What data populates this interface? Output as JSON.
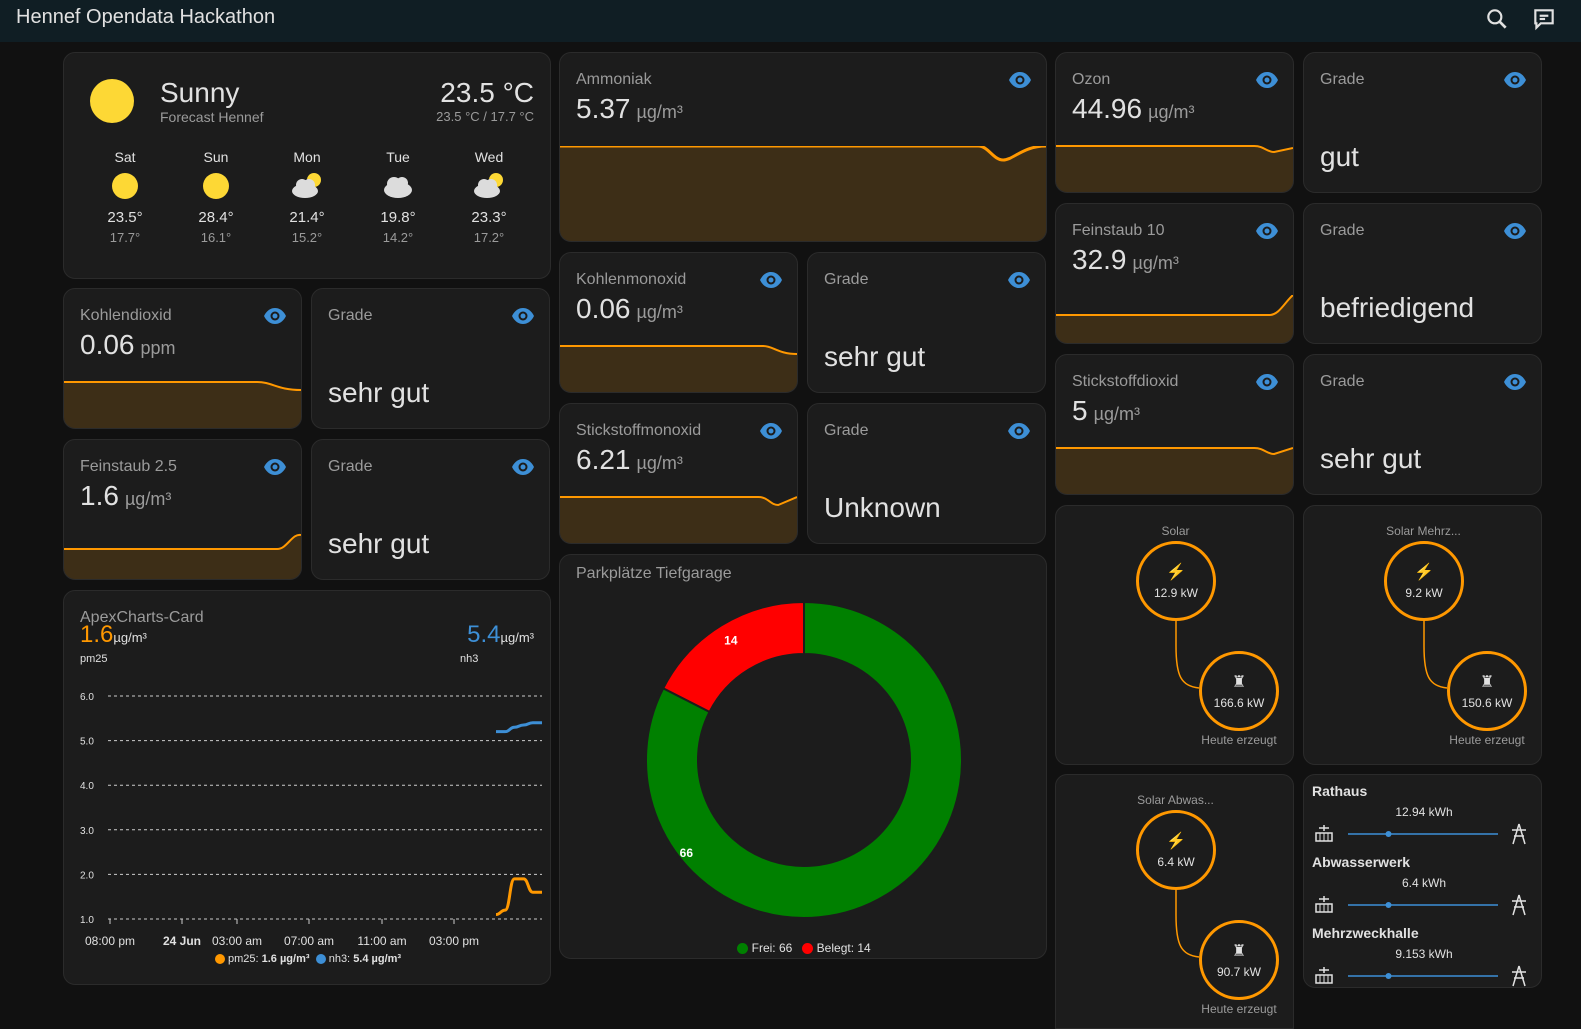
{
  "header": {
    "title": "Hennef Opendata Hackathon",
    "icons": [
      "search-icon",
      "assist-icon"
    ]
  },
  "weather": {
    "condition": "Sunny",
    "subtitle": "Forecast Hennef",
    "temperature": "23.5 °C",
    "range": "23.5 °C / 17.7 °C",
    "forecast": [
      {
        "day": "Sat",
        "icon": "sunny",
        "high": "23.5°",
        "low": "17.7°"
      },
      {
        "day": "Sun",
        "icon": "sunny",
        "high": "28.4°",
        "low": "16.1°"
      },
      {
        "day": "Mon",
        "icon": "partlycloudy",
        "high": "21.4°",
        "low": "15.2°"
      },
      {
        "day": "Tue",
        "icon": "cloudy",
        "high": "19.8°",
        "low": "14.2°"
      },
      {
        "day": "Wed",
        "icon": "partlycloudy",
        "high": "23.3°",
        "low": "17.2°"
      }
    ]
  },
  "sensors": {
    "co2": {
      "name": "Kohlendioxid",
      "value": "0.06",
      "unit": "ppm"
    },
    "pm25": {
      "name": "Feinstaub 2.5",
      "value": "1.6",
      "unit": "µg/m³"
    },
    "nh3": {
      "name": "Ammoniak",
      "value": "5.37",
      "unit": "µg/m³"
    },
    "co": {
      "name": "Kohlenmonoxid",
      "value": "0.06",
      "unit": "µg/m³"
    },
    "no": {
      "name": "Stickstoffmonoxid",
      "value": "6.21",
      "unit": "µg/m³"
    },
    "o3": {
      "name": "Ozon",
      "value": "44.96",
      "unit": "µg/m³"
    },
    "pm10": {
      "name": "Feinstaub 10",
      "value": "32.9",
      "unit": "µg/m³"
    },
    "no2": {
      "name": "Stickstoffdioxid",
      "value": "5",
      "unit": "µg/m³"
    }
  },
  "grades": {
    "label": "Grade",
    "co2": "sehr gut",
    "pm25": "sehr gut",
    "co": "sehr gut",
    "no": "Unknown",
    "o3": "gut",
    "pm10": "befriedigend",
    "no2": "sehr gut"
  },
  "apex": {
    "title": "ApexCharts-Card",
    "s1_value": "1.6",
    "s1_unit": "µg/m³",
    "s1_name": "pm25",
    "s2_value": "5.4",
    "s2_unit": "µg/m³",
    "s2_name": "nh3",
    "legend1_label": "pm25:",
    "legend1_value": "1.6 µg/m³",
    "legend2_label": "nh3:",
    "legend2_value": "5.4 µg/m³"
  },
  "chart_data": [
    {
      "type": "line",
      "title": "ApexCharts-Card",
      "y_ticks": [
        "6.0",
        "5.0",
        "4.0",
        "3.0",
        "2.0",
        "1.0"
      ],
      "ylim": [
        1.0,
        6.0
      ],
      "x_ticks": [
        "08:00 pm",
        "24 Jun",
        "03:00 am",
        "07:00 am",
        "11:00 am",
        "03:00 pm"
      ],
      "grid": true,
      "legend_position": "bottom",
      "series": [
        {
          "name": "pm25",
          "color": "#ff9800",
          "x": [
            "15:40",
            "15:50",
            "16:00",
            "16:10",
            "16:20",
            "16:30"
          ],
          "values": [
            1.1,
            1.2,
            1.9,
            1.9,
            1.6,
            1.6
          ]
        },
        {
          "name": "nh3",
          "color": "#3d8fd6",
          "x": [
            "15:40",
            "15:50",
            "16:00",
            "16:10",
            "16:20",
            "16:30"
          ],
          "values": [
            5.2,
            5.2,
            5.3,
            5.35,
            5.4,
            5.4
          ]
        }
      ]
    },
    {
      "type": "pie",
      "title": "Parkplätze Tiefgarage",
      "categories": [
        "Frei",
        "Belegt"
      ],
      "values": [
        66,
        14
      ],
      "colors": [
        "#008000",
        "#ff0000"
      ],
      "legend_labels": [
        "Frei: 66",
        "Belegt: 14"
      ]
    }
  ],
  "parking": {
    "title": "Parkplätze Tiefgarage",
    "free_value": "66",
    "occupied_value": "14",
    "legend_free": "Frei: 66",
    "legend_occupied": "Belegt: 14"
  },
  "energy": [
    {
      "title": "Solar",
      "solar": "12.9 kW",
      "grid": "166.6 kW",
      "label": "Heute erzeugt"
    },
    {
      "title": "Solar Mehrz...",
      "solar": "9.2 kW",
      "grid": "150.6 kW",
      "label": "Heute erzeugt"
    },
    {
      "title": "Solar Abwas...",
      "solar": "6.4 kW",
      "grid": "90.7 kW",
      "label": "Heute erzeugt"
    }
  ],
  "bars": [
    {
      "name": "Rathaus",
      "value": "12.94 kWh",
      "fraction": 0.27
    },
    {
      "name": "Abwasserwerk",
      "value": "6.4 kWh",
      "fraction": 0.27
    },
    {
      "name": "Mehrzweckhalle",
      "value": "9.153 kWh",
      "fraction": 0.27
    }
  ],
  "colors": {
    "accent": "#ff9800",
    "eye": "#3d8fd6",
    "green": "#008000",
    "red": "#ff0000",
    "header": "#101e24"
  }
}
